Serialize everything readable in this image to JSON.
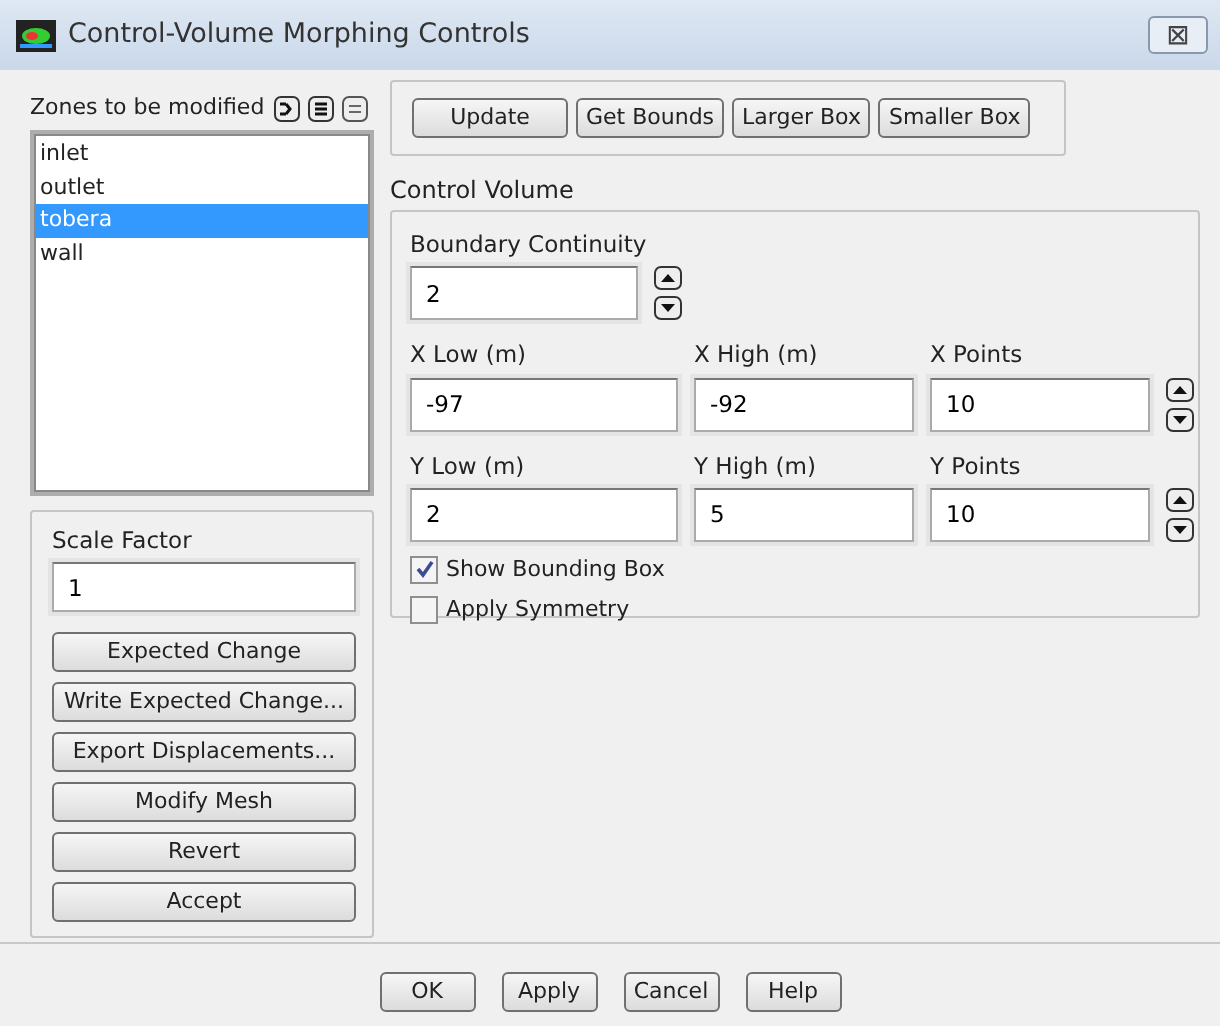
{
  "window": {
    "title": "Control-Volume Morphing Controls",
    "close": "⊠"
  },
  "zones": {
    "label": "Zones to be modified",
    "items": [
      {
        "label": "inlet",
        "selected": false
      },
      {
        "label": "outlet",
        "selected": false
      },
      {
        "label": "tobera",
        "selected": true
      },
      {
        "label": "wall",
        "selected": false
      }
    ]
  },
  "scale_factor": {
    "label": "Scale Factor",
    "value": "1"
  },
  "action_buttons": [
    "Expected Change",
    "Write Expected Change...",
    "Export Displacements...",
    "Modify Mesh",
    "Revert",
    "Accept"
  ],
  "toolbar_buttons": [
    "Update",
    "Get Bounds",
    "Larger Box",
    "Smaller Box"
  ],
  "control_volume": {
    "title": "Control Volume",
    "boundary_continuity": {
      "label": "Boundary Continuity",
      "value": "2",
      "kind": "spin"
    },
    "rows": [
      [
        {
          "label": "X Low (m)",
          "value": "-97",
          "kind": "text"
        },
        {
          "label": "X High (m)",
          "value": "-92",
          "kind": "text"
        },
        {
          "label": "X Points",
          "value": "10",
          "kind": "spin"
        }
      ],
      [
        {
          "label": "Y Low (m)",
          "value": "2",
          "kind": "text"
        },
        {
          "label": "Y High (m)",
          "value": "5",
          "kind": "text"
        },
        {
          "label": "Y Points",
          "value": "10",
          "kind": "spin"
        }
      ]
    ],
    "checkboxes": [
      {
        "label": "Show Bounding Box",
        "checked": true
      },
      {
        "label": "Apply Symmetry",
        "checked": false
      }
    ]
  },
  "dialog_buttons": [
    "OK",
    "Apply",
    "Cancel",
    "Help"
  ]
}
